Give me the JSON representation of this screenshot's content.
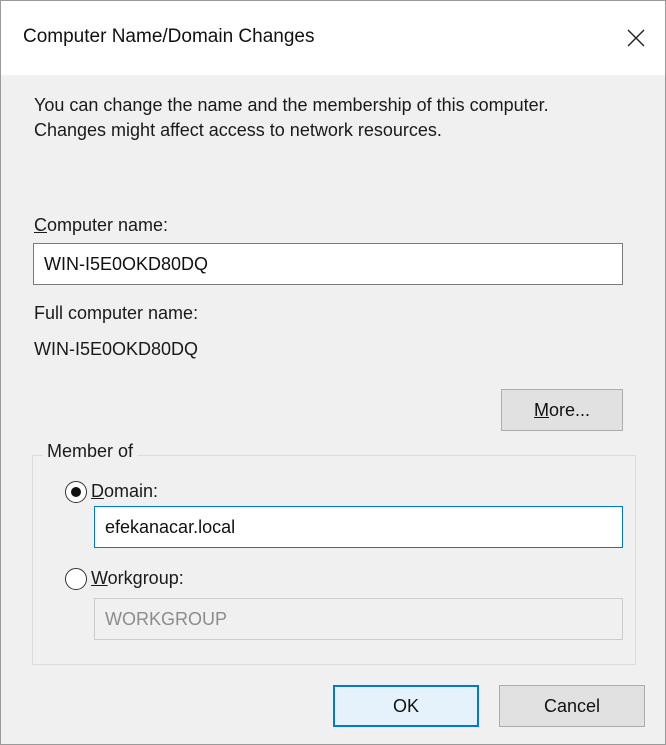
{
  "window": {
    "title": "Computer Name/Domain Changes",
    "close_glyph": "✕"
  },
  "description": {
    "line1": "You can change the name and the membership of this computer.",
    "line2": "Changes might affect access to network resources."
  },
  "computer_name": {
    "label_mnemonic": "C",
    "label_rest": "omputer name:",
    "value": "WIN-I5E0OKD80DQ"
  },
  "full_name": {
    "label": "Full computer name:",
    "value": "WIN-I5E0OKD80DQ"
  },
  "more_button": {
    "mnemonic": "M",
    "rest": "ore..."
  },
  "member_of": {
    "legend": "Member of",
    "domain": {
      "label_mnemonic": "D",
      "label_rest": "omain:",
      "value": "efekanacar.local",
      "selected": true
    },
    "workgroup": {
      "label_mnemonic": "W",
      "label_rest": "orkgroup:",
      "value": "WORKGROUP",
      "selected": false
    }
  },
  "buttons": {
    "ok": "OK",
    "cancel": "Cancel"
  },
  "colors": {
    "accent": "#0078d7",
    "dialog_bg": "#f0f0f0",
    "titlebar_bg": "#ffffff"
  }
}
